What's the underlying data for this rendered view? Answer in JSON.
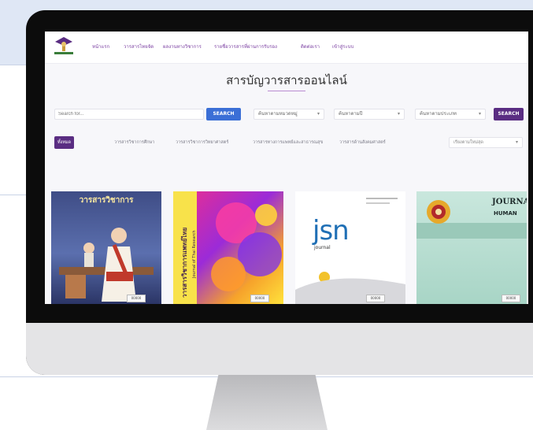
{
  "site": {
    "logo_icon": "university-logo-icon",
    "nav": [
      "หน้าแรก",
      "วารสารไทยจัด",
      "ผลงานทางวิชาการ",
      "รายชื่อวารสารที่ผ่านการรับรอง",
      "ติดต่อเรา",
      "เข้าสู่ระบบ"
    ]
  },
  "page": {
    "title": "สารบัญวารสารออนไลน์"
  },
  "search": {
    "placeholder": "Search for...",
    "button_label": "SEARCH",
    "filter1": "ค้นหาตามหมวดหมู่",
    "filter2": "ค้นหาตามปี",
    "filter3": "ค้นหาตามประเภท",
    "button2_label": "SEARCH"
  },
  "tabs": {
    "items": [
      "ทั้งหมด",
      "วารสารวิชาการศึกษา",
      "วารสารวิชาการวิทยาศาสตร์",
      "วารสารทางการแพทย์และสาธารณสุข",
      "วารสารด้านสังคมศาสตร์"
    ],
    "sort_select": "เรียงตามใหม่สุด"
  },
  "journals": [
    {
      "cover_text": "วารสารวิชาการ",
      "label": "00000"
    },
    {
      "cover_text": "วารสารวิชาการแพทย์ไทย",
      "cover_subtext": "Journal of Thai Research",
      "label": "00000"
    },
    {
      "cover_text": "jsn",
      "cover_subtext": "journal",
      "label": "00000"
    },
    {
      "cover_text": "JOURNAL",
      "cover_subtext": "HUMAN",
      "label": "00000"
    }
  ],
  "colors": {
    "accent": "#5a2d82",
    "search_button": "#3b6fd6",
    "monitor_frame": "#0c0c0c"
  }
}
